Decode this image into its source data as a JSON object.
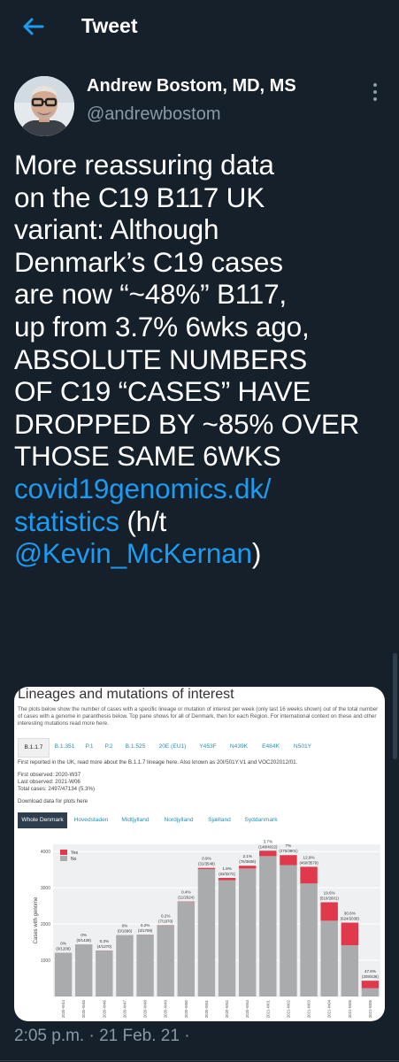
{
  "header": {
    "title": "Tweet"
  },
  "author": {
    "name": "Andrew Bostom, MD, MS",
    "handle": "@andrewbostom"
  },
  "tweet": {
    "lines": [
      "More reassuring data",
      "on the C19 B117 UK",
      "variant: Although",
      "Denmark’s C19 cases",
      "are now “~48%” B117,",
      "up from 3.7% 6wks ago,",
      "ABSOLUTE NUMBERS",
      "OF C19 “CASES” HAVE",
      "DROPPED BY ~85% OVER",
      "THOSE SAME 6WKS"
    ],
    "link_part1": "covid19genomics.dk/",
    "link_part2": "statistics",
    "after_link": " (h/t",
    "mention": "@Kevin_McKernan",
    "closing": ")"
  },
  "timestamp": "2:05 p.m. · 21 Feb. 21 ·",
  "colors": {
    "background": "#15202b",
    "accent": "#1d9bf0",
    "secondary_text": "#8b98a5",
    "bar_no": "#a9abad",
    "bar_yes": "#e0394c"
  },
  "icons": {
    "back": "arrow-left-icon",
    "more": "more-vertical-icon"
  },
  "card": {
    "title": "Lineages and mutations of interest",
    "description": "The plots below show the number of cases with a specific lineage or mutation of interest per week (only last 16 weeks shown) out of the total number of cases with a genome in paranthesis below. Top pane shows for all of Denmark, then for each Region. For international context on these and other interesting mutations read more here.",
    "lineage_tabs": [
      "B.1.1.7",
      "B.1.351",
      "P.1",
      "P.2",
      "B.1.525",
      "20E (EU1)",
      "Y453F",
      "N439K",
      "E484K",
      "N501Y"
    ],
    "first_reported": "First reported in the UK, read more about the B.1.1.7 lineage here. Also known as 20I/501Y.V1 and VOC202012/01.",
    "first_observed": "First observed: 2020-W37",
    "last_observed": "Last observed: 2021-W06",
    "total_cases": "Total cases: 2497/47134 (5.3%)",
    "download": "Download data for plots here",
    "region_tabs": [
      "Whole Denmark",
      "Hovedstaden",
      "Midtjylland",
      "Nordjylland",
      "Sjælland",
      "Syddanmark"
    ]
  },
  "chart_data": {
    "type": "bar",
    "stacked": true,
    "ylabel": "Cases with genome",
    "ylim": [
      0,
      4200
    ],
    "yticks": [
      1000,
      2000,
      3000,
      4000
    ],
    "legend": [
      "Yes",
      "No"
    ],
    "legend_position": "top-left",
    "categories": [
      "2020-W44",
      "2020-W45",
      "2020-W46",
      "2020-W47",
      "2020-W48",
      "2020-W49",
      "2020-W50",
      "2020-W51",
      "2020-W52",
      "2020-W53",
      "2021-W01",
      "2021-W02",
      "2021-W03",
      "2021-W04",
      "2021-W05",
      "2021-W06"
    ],
    "series": [
      {
        "name": "Yes",
        "values": [
          0,
          0,
          4,
          0,
          3,
          7,
          9,
          31,
          63,
          76,
          148,
          275,
          460,
          510,
          624,
          208
        ]
      },
      {
        "name": "No",
        "values": [
          1208,
          1439,
          1266,
          1696,
          1706,
          1963,
          2615,
          3517,
          3209,
          3532,
          3874,
          3626,
          3119,
          2091,
          1414,
          228
        ]
      }
    ],
    "totals": [
      1208,
      1439,
      1270,
      1696,
      1709,
      1970,
      2624,
      3548,
      3272,
      3608,
      4022,
      3901,
      3579,
      2601,
      2038,
      436
    ],
    "bar_labels_pct": [
      "0%",
      "0%",
      "0.3%",
      "0%",
      "0.2%",
      "0.2%",
      "0.4%",
      "0.9%",
      "1.9%",
      "2.1%",
      "3.7%",
      "7%",
      "12.9%",
      "19.6%",
      "30.6%",
      "47.6%"
    ],
    "bar_labels_count": [
      "(0/1208)",
      "(0/1439)",
      "(4/1270)",
      "(0/1696)",
      "(3/1709)",
      "(7/1970)",
      "(11/2624)",
      "(31/3548)",
      "(63/3272)",
      "(76/3608)",
      "(148/4022)",
      "(275/3901)",
      "(460/3579)",
      "(510/2601)",
      "(624/2038)",
      "(208/436)"
    ]
  }
}
